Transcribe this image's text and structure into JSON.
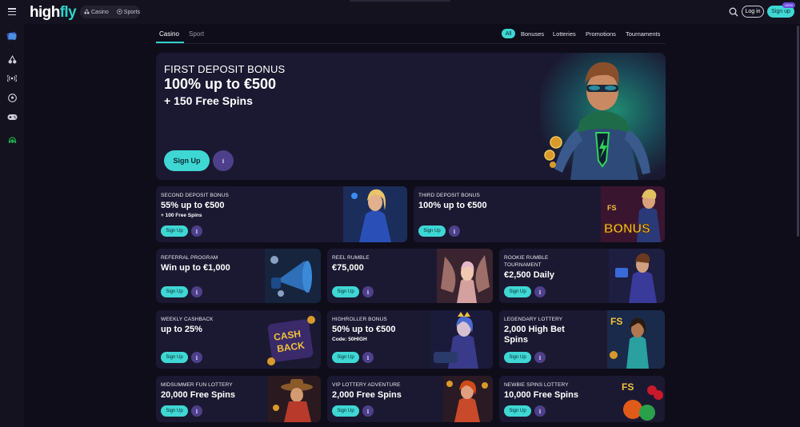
{
  "brand": {
    "logo_high": "high",
    "logo_fly": "fly"
  },
  "header": {
    "toggle": [
      {
        "label": "Casino",
        "icon": "cherries-icon"
      },
      {
        "label": "Sports",
        "icon": "soccer-ball-icon"
      }
    ],
    "login_label": "Log in",
    "signup_label": "Sign up",
    "signup_badge": "100%"
  },
  "sidebar": {
    "items": [
      {
        "name": "promo-card-icon"
      },
      {
        "name": "cherries-icon"
      },
      {
        "name": "live-broadcast-icon"
      },
      {
        "name": "soccer-ball-icon"
      },
      {
        "name": "gamepad-icon"
      },
      {
        "name": "support-headset-icon"
      }
    ]
  },
  "tabs": [
    {
      "label": "Casino"
    },
    {
      "label": "Sport"
    }
  ],
  "filters": [
    {
      "label": "All"
    },
    {
      "label": "Bonuses"
    },
    {
      "label": "Lotteries"
    },
    {
      "label": "Promotions"
    },
    {
      "label": "Tournaments"
    }
  ],
  "hero": {
    "eyebrow": "FIRST DEPOSIT BONUS",
    "title": "100% up to €500",
    "subtitle": "+ 150 Free Spins",
    "button": "Sign Up"
  },
  "cards": [
    {
      "eyebrow": "SECOND DEPOSIT BONUS",
      "title": "55% up to €500",
      "sub": "+ 100 Free Spins",
      "button": "Sign Up"
    },
    {
      "eyebrow": "THIRD DEPOSIT BONUS",
      "title": "100% up to €500",
      "button": "Sign Up"
    },
    {
      "eyebrow": "REFERRAL PROGRAM",
      "title": "Win up to €1,000",
      "button": "Sign Up"
    },
    {
      "eyebrow": "REEL RUMBLE",
      "title": "€75,000",
      "button": "Sign Up"
    },
    {
      "eyebrow": "ROOKIE RUMBLE",
      "eyebrow2": "TOURNAMENT",
      "title": "€2,500 Daily",
      "button": "Sign Up"
    },
    {
      "eyebrow": "WEEKLY CASHBACK",
      "title": "up to 25%",
      "button": "Sign Up"
    },
    {
      "eyebrow": "HIGHROLLER BONUS",
      "title": "50% up to €500",
      "sub": "Code: 50HIGH",
      "button": "Sign Up"
    },
    {
      "eyebrow": "LEGENDARY LOTTERY",
      "title": "2,000 High Bet",
      "title2": "Spins",
      "button": "Sign Up"
    },
    {
      "eyebrow": "MIDSUMMER FUN LOTTERY",
      "title": "20,000 Free Spins",
      "button": "Sign Up"
    },
    {
      "eyebrow": "VIP LOTTERY ADVENTURE",
      "title": "2,000 Free Spins",
      "button": "Sign Up"
    },
    {
      "eyebrow": "NEWBIE SPINS LOTTERY",
      "title": "10,000 Free Spins",
      "button": "Sign Up"
    }
  ],
  "art_text": {
    "bonus": "BONUS",
    "cash": "CASH",
    "back": "BACK",
    "fs": "FS"
  },
  "colors": {
    "accent": "#3fd7d4",
    "bg": "#0f0d1a",
    "card": "#1b1931",
    "info": "#4e3f8a"
  }
}
